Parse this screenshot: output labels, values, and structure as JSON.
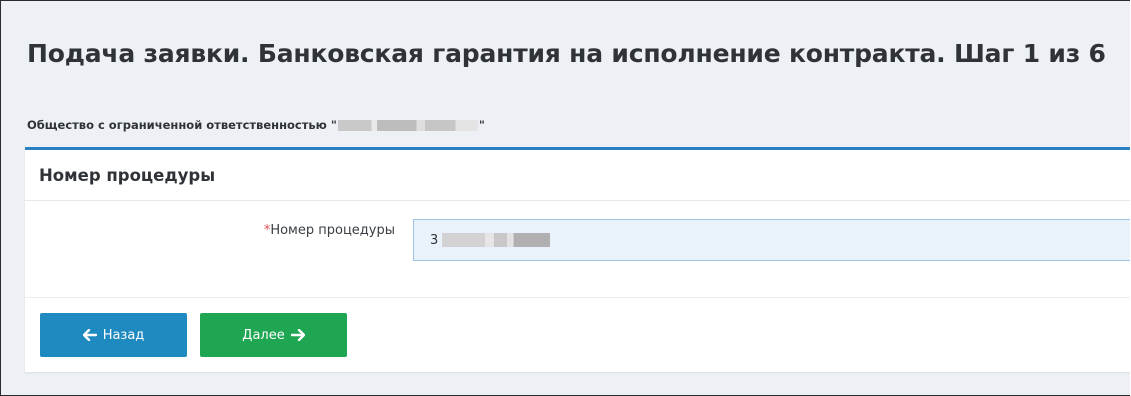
{
  "page": {
    "title": "Подача заявки. Банковская гарантия на исполнение контракта. Шаг 1 из 6"
  },
  "organization": {
    "prefix": "Общество с ограниченной ответственностью \"",
    "suffix": "\""
  },
  "panel": {
    "title": "Номер процедуры",
    "field": {
      "required_mark": "*",
      "label": "Номер процедуры",
      "value_visible": "3"
    }
  },
  "buttons": {
    "back": {
      "label": "Назад",
      "icon": "arrow-left-icon"
    },
    "next": {
      "label": "Далее",
      "icon": "arrow-right-icon"
    }
  },
  "colors": {
    "accent": "#2a7fc1",
    "back_button": "#1f8ac0",
    "next_button": "#1ea653",
    "required": "#d9534f",
    "background": "#edf1f6"
  }
}
